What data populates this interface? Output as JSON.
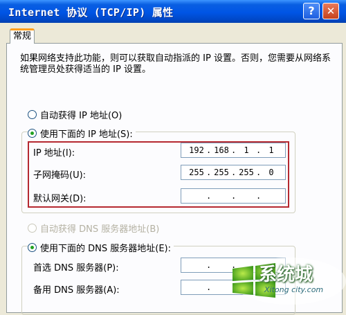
{
  "window": {
    "title": "Internet 协议 (TCP/IP) 属性",
    "help_label": "?",
    "close_label": "✕"
  },
  "tabs": [
    {
      "label": "常规"
    }
  ],
  "description": "如果网络支持此功能，则可以获取自动指派的 IP 设置。否则，您需要从网络系统管理员处获得适当的 IP 设置。",
  "ip_section": {
    "auto_option": "自动获得 IP 地址(O)",
    "manual_option": "使用下面的 IP 地址(S):",
    "selected": "manual",
    "fields": [
      {
        "label": "IP 地址(I):",
        "octets": [
          "192",
          "168",
          "1",
          "1"
        ]
      },
      {
        "label": "子网掩码(U):",
        "octets": [
          "255",
          "255",
          "255",
          "0"
        ]
      },
      {
        "label": "默认网关(D):",
        "octets": [
          "",
          "",
          "",
          ""
        ]
      }
    ]
  },
  "dns_section": {
    "auto_option": "自动获得 DNS 服务器地址(B)",
    "manual_option": "使用下面的 DNS 服务器地址(E):",
    "selected": "manual",
    "fields": [
      {
        "label": "首选 DNS 服务器(P):",
        "octets": [
          "",
          "",
          "",
          ""
        ]
      },
      {
        "label": "备用 DNS 服务器(A):",
        "octets": [
          "",
          "",
          "",
          ""
        ]
      }
    ]
  },
  "watermark": {
    "logo_text": "系统城",
    "url": "Xitong city.com"
  },
  "colors": {
    "titlebar": "#0055e5",
    "highlight_box": "#b52830",
    "radio_dot": "#21a121",
    "tab_accent": "#ff9f1c"
  }
}
